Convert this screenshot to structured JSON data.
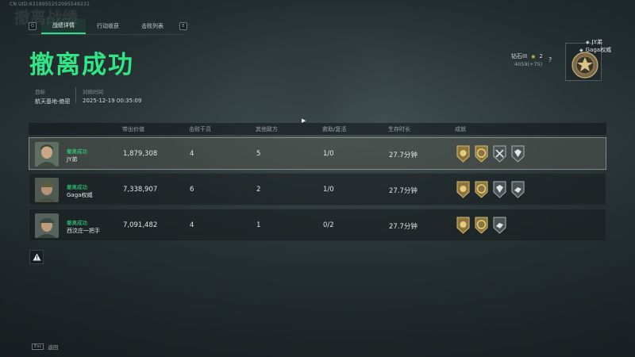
{
  "header": {
    "uid": "CN UID:6318955252095549231",
    "ghost_title": "撤离战绩",
    "headline": "撤离成功"
  },
  "tabs": [
    {
      "label": "战绩详情",
      "active": true
    },
    {
      "label": "行动收获",
      "active": false
    },
    {
      "label": "击败列表",
      "active": false
    }
  ],
  "key_hints": {
    "left": "Q",
    "right": "E"
  },
  "meta": {
    "target_label": "目标",
    "target_value": "航天基地-绝密",
    "time_label": "对局时间",
    "time_value": "2025-12-19 00:35:09"
  },
  "rank": {
    "tier": "钻石III",
    "stars": "2",
    "points": "4059(+75)",
    "help": "?"
  },
  "squad": [
    {
      "name": "JY弟"
    },
    {
      "name": "Gaga权威"
    }
  ],
  "table": {
    "headers": [
      "带出价值",
      "击败干员",
      "其他敌方",
      "救助/复活",
      "生存时长",
      "成就"
    ],
    "rows": [
      {
        "status": "撤离成功",
        "name": "JY弟",
        "value": "1,879,308",
        "kills": "4",
        "other": "5",
        "rescue": "1/0",
        "survive": "27.7分钟",
        "medals": 4,
        "self": true
      },
      {
        "status": "撤离成功",
        "name": "Gaga权威",
        "value": "7,338,907",
        "kills": "6",
        "other": "2",
        "rescue": "1/0",
        "survive": "27.7分钟",
        "medals": 4,
        "self": false
      },
      {
        "status": "撤离成功",
        "name": "西汶庄一把手",
        "value": "7,091,482",
        "kills": "4",
        "other": "1",
        "rescue": "0/2",
        "survive": "27.7分钟",
        "medals": 3,
        "self": false
      }
    ]
  },
  "footer": {
    "key": "Esc",
    "label": "返回"
  },
  "colors": {
    "accent": "#2fe585",
    "gold": "#c9a548"
  },
  "icons": [
    "warning-icon",
    "star-icon",
    "medal-icon",
    "team-badge-icon",
    "avatar-icon"
  ]
}
